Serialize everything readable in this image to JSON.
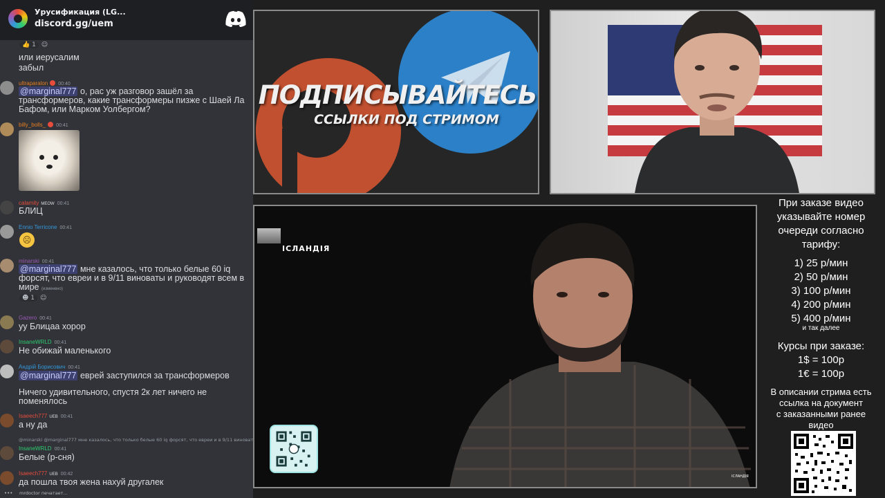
{
  "discord": {
    "server_name": "Урусификация (LG...",
    "invite": "discord.gg/uem",
    "typing": "mrdoctor печатает..."
  },
  "messages": [
    {
      "text": "или иерусалим"
    },
    {
      "text": "забыл"
    },
    {
      "user": "ultraparalon",
      "time": "00:40",
      "user_color": "#e67e22",
      "mention": "@marginal777",
      "text": " о, рас уж разговор зашёл за трансформеров, какие трансформеры пизже с Шаей Ла Бафом, или Марком Уолбергом?"
    },
    {
      "user": "billy_bolls_",
      "time": "00:41",
      "user_color": "#e67e22"
    },
    {
      "user": "calamity",
      "tag": "MEOW",
      "time": "00:41",
      "user_color": "#e74c3c",
      "text": "БЛИЦ"
    },
    {
      "user": "Ennio Terricone",
      "time": "00:41",
      "user_color": "#3498db"
    },
    {
      "user": "minarski",
      "time": "00:41",
      "user_color": "#9b59b6",
      "mention": "@marginal777",
      "text": " мне казалось, что только белые 60 iq форсят, что евреи и в 9/11 виноваты и руководят всем в мире",
      "edited": "(изменено)",
      "reaction": "1"
    },
    {
      "user": "Gazero",
      "time": "00:41",
      "user_color": "#9b59b6",
      "text": "уу Блицаа хорор"
    },
    {
      "user": "InsaneWRLD",
      "time": "00:41",
      "user_color": "#2ecc71",
      "text": "Не обижай маленького"
    },
    {
      "user": "Андрій Борисович",
      "time": "00:41",
      "user_color": "#3498db",
      "mention": "@marginal777",
      "text": " еврей заступился за трансформеров"
    },
    {
      "text": "Ничего удивительного, спустя 2к лет ничего не поменялось"
    },
    {
      "user": "Isaeech777",
      "tag": "UEB",
      "time": "00:41",
      "user_color": "#e74c3c",
      "text": "а ну да"
    },
    {
      "reply": "@minarski @marginal777 мне казалось, что только белые 60 iq форсят, что евреи и в 9/11 виноваты"
    },
    {
      "user": "InsaneWRLD",
      "time": "00:41",
      "user_color": "#2ecc71",
      "text": "Белые (р-сня)"
    },
    {
      "user": "Isaeech777",
      "tag": "UEB",
      "time": "00:42",
      "user_color": "#e74c3c",
      "text": "да пошла твоя жена нахуй другалек"
    }
  ],
  "promo": {
    "title": "ПОДПИСЫВАЙТЕСЬ",
    "subtitle": "ССЫЛКИ ПОД СТРИМОМ"
  },
  "video": {
    "channel": "ІСЛАНДІЯ",
    "logo": "ІСЛАНДІЯ"
  },
  "info": {
    "head": [
      "При заказе видео",
      "указывайте номер",
      "очереди согласно",
      "тарифу:"
    ],
    "prices": [
      "1) 25 р/мин",
      "2) 50 р/мин",
      "3) 100 р/мин",
      "4) 200 р/мин",
      "5) 400 р/мин"
    ],
    "more": "и так далее",
    "course_title": "Курсы при заказе:",
    "course": [
      "1$ = 100р",
      "1€ = 100р"
    ],
    "desc": [
      "В описании стрима есть",
      "ссылка на документ",
      "с заказанными ранее",
      "видео"
    ]
  },
  "colors": {
    "discord_bg": "#313338",
    "mention_bg": "#5865f2",
    "telegram_blue": "#2b80c8",
    "patreon_orange": "#c0502f"
  }
}
